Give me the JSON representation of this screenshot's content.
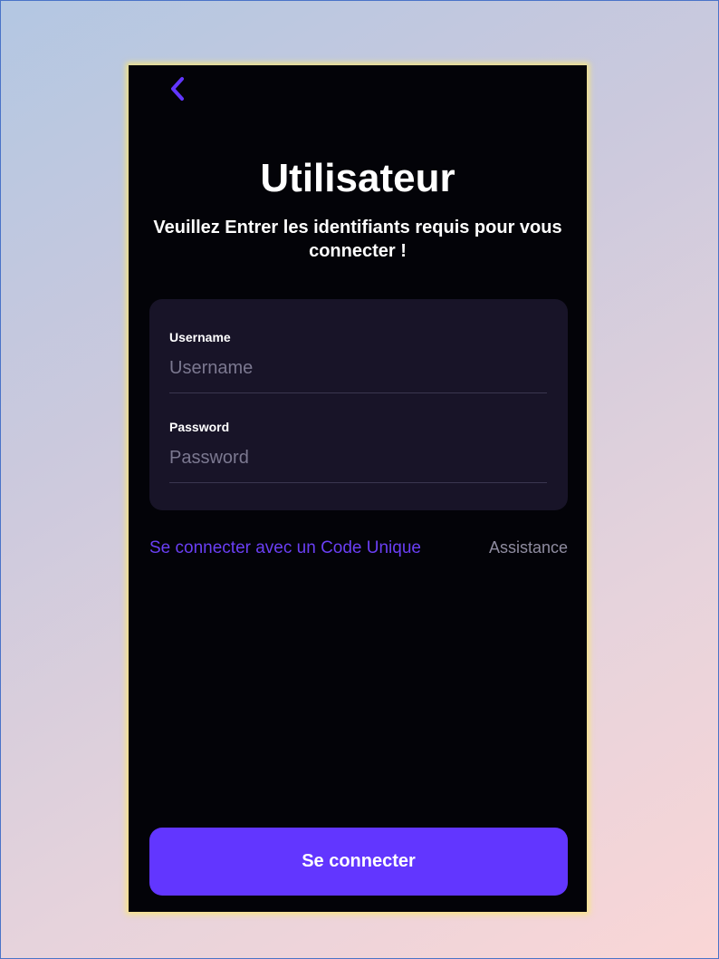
{
  "accent_color": "#6236ff",
  "header": {
    "back_icon": "chevron-left-icon"
  },
  "title": "Utilisateur",
  "subtitle": "Veuillez Entrer les identifiants requis pour vous connecter !",
  "form": {
    "username": {
      "label": "Username",
      "value": "",
      "placeholder": "Username"
    },
    "password": {
      "label": "Password",
      "value": "",
      "placeholder": "Password"
    }
  },
  "links": {
    "code_login": "Se connecter avec un Code Unique",
    "assistance": "Assistance"
  },
  "submit_label": "Se connecter"
}
